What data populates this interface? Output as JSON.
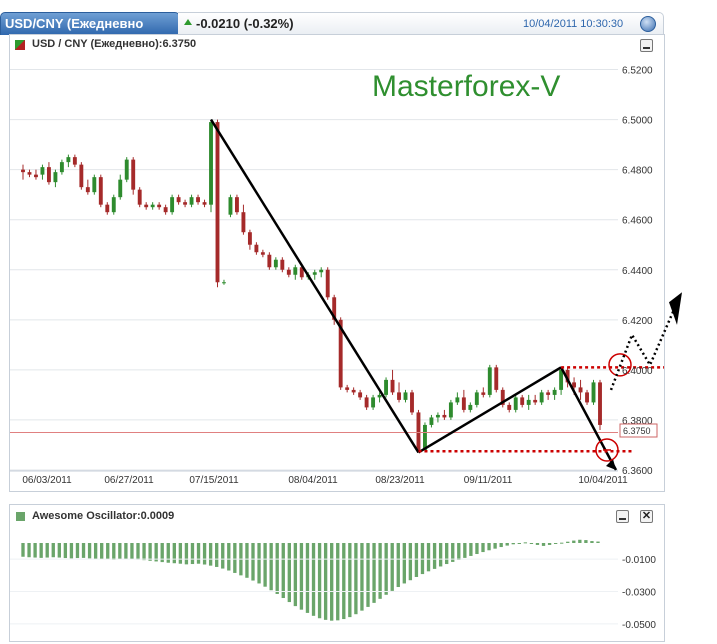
{
  "header": {
    "tab_title": "USD/CNY (Ежедневно",
    "change": "-0.0210 (-0.32%)",
    "timestamp": "10/04/2011 10:30:30"
  },
  "main_panel": {
    "title": "USD / CNY (Ежедневно):6.3750",
    "brand": "Masterforex-V",
    "last_price_label": "6.3750"
  },
  "osc_panel": {
    "title": "Awesome Oscillator:0.0009"
  },
  "colors": {
    "up": "#2e8b2e",
    "down": "#a52a2a",
    "accent": "#2f67ad",
    "marker": "#cc0000"
  },
  "chart_data": [
    {
      "type": "candlestick",
      "series_name": "USD / CNY (Ежедневно)",
      "last": 6.375,
      "x_tick_labels": [
        "06/03/2011",
        "06/27/2011",
        "07/15/2011",
        "08/04/2011",
        "08/23/2011",
        "09/11/2011",
        "10/04/2011"
      ],
      "y_tick_labels": [
        "6.5200",
        "6.5000",
        "6.4800",
        "6.4600",
        "6.4400",
        "6.4200",
        "6.4000",
        "6.3800",
        "6.3600"
      ],
      "ylim": [
        6.356,
        6.527
      ],
      "grid": true,
      "ohlc": [
        [
          6.48,
          6.482,
          6.476,
          6.479
        ],
        [
          6.479,
          6.48,
          6.477,
          6.478
        ],
        [
          6.478,
          6.48,
          6.476,
          6.477
        ],
        [
          6.478,
          6.482,
          6.476,
          6.481
        ],
        [
          6.481,
          6.483,
          6.474,
          6.475
        ],
        [
          6.475,
          6.48,
          6.473,
          6.479
        ],
        [
          6.479,
          6.484,
          6.478,
          6.483
        ],
        [
          6.483,
          6.486,
          6.481,
          6.485
        ],
        [
          6.485,
          6.486,
          6.481,
          6.482
        ],
        [
          6.482,
          6.483,
          6.472,
          6.473
        ],
        [
          6.473,
          6.476,
          6.47,
          6.471
        ],
        [
          6.471,
          6.478,
          6.47,
          6.477
        ],
        [
          6.477,
          6.478,
          6.465,
          6.466
        ],
        [
          6.466,
          6.467,
          6.462,
          6.463
        ],
        [
          6.463,
          6.47,
          6.462,
          6.469
        ],
        [
          6.469,
          6.478,
          6.468,
          6.476
        ],
        [
          6.476,
          6.485,
          6.475,
          6.484
        ],
        [
          6.484,
          6.485,
          6.47,
          6.472
        ],
        [
          6.472,
          6.473,
          6.465,
          6.466
        ],
        [
          6.466,
          6.467,
          6.464,
          6.465
        ],
        [
          6.465,
          6.467,
          6.464,
          6.466
        ],
        [
          6.466,
          6.467,
          6.464,
          6.465
        ],
        [
          6.465,
          6.466,
          6.462,
          6.463
        ],
        [
          6.463,
          6.47,
          6.462,
          6.469
        ],
        [
          6.469,
          6.47,
          6.466,
          6.467
        ],
        [
          6.467,
          6.468,
          6.465,
          6.466
        ],
        [
          6.466,
          6.47,
          6.465,
          6.469
        ],
        [
          6.469,
          6.47,
          6.466,
          6.467
        ],
        [
          6.467,
          6.468,
          6.465,
          6.466
        ],
        [
          6.466,
          6.5,
          6.463,
          6.499
        ],
        [
          6.499,
          6.5,
          6.433,
          6.435
        ],
        [
          6.435,
          6.436,
          6.434,
          6.435
        ],
        [
          6.462,
          6.47,
          6.461,
          6.469
        ],
        [
          6.469,
          6.47,
          6.462,
          6.463
        ],
        [
          6.463,
          6.466,
          6.454,
          6.455
        ],
        [
          6.455,
          6.456,
          6.448,
          6.45
        ],
        [
          6.45,
          6.451,
          6.446,
          6.447
        ],
        [
          6.447,
          6.448,
          6.445,
          6.446
        ],
        [
          6.446,
          6.447,
          6.44,
          6.441
        ],
        [
          6.441,
          6.445,
          6.44,
          6.444
        ],
        [
          6.444,
          6.445,
          6.439,
          6.44
        ],
        [
          6.44,
          6.441,
          6.437,
          6.438
        ],
        [
          6.438,
          6.442,
          6.436,
          6.441
        ],
        [
          6.441,
          6.442,
          6.436,
          6.437
        ],
        [
          6.437,
          6.439,
          6.436,
          6.438
        ],
        [
          6.438,
          6.44,
          6.436,
          6.439
        ],
        [
          6.439,
          6.441,
          6.437,
          6.44
        ],
        [
          6.44,
          6.441,
          6.428,
          6.429
        ],
        [
          6.429,
          6.43,
          6.418,
          6.42
        ],
        [
          6.42,
          6.421,
          6.392,
          6.393
        ],
        [
          6.393,
          6.394,
          6.391,
          6.392
        ],
        [
          6.392,
          6.393,
          6.39,
          6.391
        ],
        [
          6.391,
          6.392,
          6.388,
          6.389
        ],
        [
          6.389,
          6.39,
          6.384,
          6.385
        ],
        [
          6.385,
          6.39,
          6.384,
          6.389
        ],
        [
          6.389,
          6.391,
          6.387,
          6.39
        ],
        [
          6.39,
          6.397,
          6.389,
          6.396
        ],
        [
          6.396,
          6.4,
          6.39,
          6.391
        ],
        [
          6.391,
          6.395,
          6.387,
          6.388
        ],
        [
          6.388,
          6.392,
          6.387,
          6.391
        ],
        [
          6.391,
          6.392,
          6.382,
          6.383
        ],
        [
          6.383,
          6.384,
          6.367,
          6.368
        ],
        [
          6.368,
          6.379,
          6.367,
          6.378
        ],
        [
          6.378,
          6.382,
          6.377,
          6.381
        ],
        [
          6.381,
          6.383,
          6.379,
          6.382
        ],
        [
          6.382,
          6.384,
          6.38,
          6.381
        ],
        [
          6.381,
          6.388,
          6.38,
          6.387
        ],
        [
          6.387,
          6.391,
          6.386,
          6.389
        ],
        [
          6.389,
          6.392,
          6.383,
          6.384
        ],
        [
          6.384,
          6.387,
          6.383,
          6.386
        ],
        [
          6.386,
          6.392,
          6.385,
          6.391
        ],
        [
          6.391,
          6.393,
          6.389,
          6.39
        ],
        [
          6.39,
          6.402,
          6.389,
          6.401
        ],
        [
          6.401,
          6.402,
          6.391,
          6.392
        ],
        [
          6.392,
          6.393,
          6.385,
          6.386
        ],
        [
          6.386,
          6.387,
          6.383,
          6.384
        ],
        [
          6.384,
          6.39,
          6.383,
          6.389
        ],
        [
          6.389,
          6.39,
          6.385,
          6.386
        ],
        [
          6.386,
          6.39,
          6.384,
          6.388
        ],
        [
          6.388,
          6.39,
          6.386,
          6.387
        ],
        [
          6.387,
          6.392,
          6.386,
          6.391
        ],
        [
          6.391,
          6.392,
          6.388,
          6.39
        ],
        [
          6.39,
          6.393,
          6.388,
          6.392
        ],
        [
          6.392,
          6.401,
          6.39,
          6.4
        ],
        [
          6.4,
          6.401,
          6.393,
          6.395
        ],
        [
          6.395,
          6.397,
          6.39,
          6.393
        ],
        [
          6.393,
          6.396,
          6.388,
          6.391
        ],
        [
          6.391,
          6.392,
          6.386,
          6.387
        ],
        [
          6.387,
          6.396,
          6.386,
          6.395
        ],
        [
          6.395,
          6.396,
          6.376,
          6.378
        ]
      ]
    },
    {
      "type": "bar",
      "series_name": "Awesome Oscillator",
      "last": 0.0009,
      "y_tick_labels": [
        "-0.0100",
        "-0.0300",
        "-0.0500"
      ],
      "ylim": [
        -0.055,
        0.005
      ],
      "values": [
        -0.0085,
        -0.0088,
        -0.009,
        -0.0092,
        -0.009,
        -0.0088,
        -0.009,
        -0.0093,
        -0.0095,
        -0.0093,
        -0.0092,
        -0.0095,
        -0.0098,
        -0.01,
        -0.0102,
        -0.0104,
        -0.01,
        -0.0098,
        -0.01,
        -0.0103,
        -0.0106,
        -0.011,
        -0.0114,
        -0.0118,
        -0.0122,
        -0.0125,
        -0.0128,
        -0.0132,
        -0.013,
        -0.0128,
        -0.0133,
        -0.014,
        -0.0148,
        -0.0158,
        -0.017,
        -0.0185,
        -0.02,
        -0.0215,
        -0.0232,
        -0.025,
        -0.027,
        -0.0292,
        -0.0315,
        -0.034,
        -0.0365,
        -0.039,
        -0.0412,
        -0.0432,
        -0.045,
        -0.0465,
        -0.0475,
        -0.048,
        -0.0478,
        -0.047,
        -0.0458,
        -0.044,
        -0.0418,
        -0.0395,
        -0.037,
        -0.0345,
        -0.032,
        -0.0296,
        -0.0272,
        -0.025,
        -0.023,
        -0.021,
        -0.0192,
        -0.0175,
        -0.016,
        -0.0145,
        -0.013,
        -0.0117,
        -0.0105,
        -0.0092,
        -0.008,
        -0.0068,
        -0.0056,
        -0.0045,
        -0.0035,
        -0.0025,
        -0.0016,
        -0.0008,
        -0.0002,
        0.0004,
        -0.0003,
        -0.0012,
        -0.0018,
        -0.0012,
        -0.0005,
        0.0002,
        0.0008,
        0.0015,
        0.002,
        0.0018,
        0.0012,
        0.0009
      ]
    }
  ]
}
